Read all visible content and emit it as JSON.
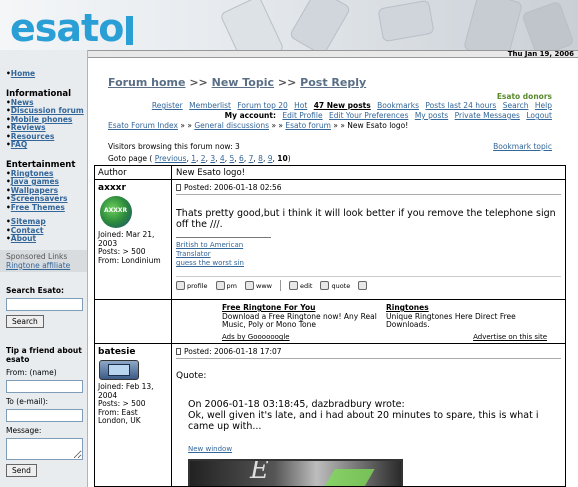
{
  "brand": {
    "logo": "esato"
  },
  "date": "Thu Jan 19, 2006",
  "sidebar": {
    "home": "Home",
    "informational_title": "Informational",
    "informational": [
      "News",
      "Discussion forum",
      "Mobile phones",
      "Reviews",
      "Resources",
      "FAQ"
    ],
    "entertainment_title": "Entertainment",
    "entertainment": [
      "Ringtones",
      "Java games",
      "Wallpapers",
      "Screensavers",
      "Free Themes"
    ],
    "misc": [
      "Sitemap",
      "Contact",
      "About"
    ],
    "sponsored_title": "Sponsored Links",
    "sponsored_link": "Ringtone affiliate",
    "search_label": "Search Esato:",
    "search_button": "Search",
    "tip_title": "Tip a friend about esato",
    "from_label": "From: (name)",
    "to_label": "To (e-mail):",
    "message_label": "Message:",
    "send_button": "Send"
  },
  "main": {
    "breadcrumb": {
      "home": "Forum home",
      "sep1": ">>",
      "new_topic": "New Topic",
      "sep2": ">>",
      "post_reply": "Post Reply"
    },
    "donors": "Esato donors",
    "nav": [
      "Register",
      "Memberlist",
      "Forum top 20",
      "Hot"
    ],
    "nav_bold": "47 New posts",
    "nav2": [
      "Bookmarks",
      "Posts last 24 hours",
      "Search",
      "Help"
    ],
    "account_label": "My account:",
    "account": [
      "Edit Profile",
      "Edit Your Preferences",
      "My posts",
      "Private Messages",
      "Logout"
    ],
    "index_path": [
      "Esato Forum Index",
      "General discussions",
      "Esato forum"
    ],
    "index_sep": "»",
    "index_current": "New Esato logo!",
    "browsing": "Visitors browsing this forum now: 3",
    "bookmark": "Bookmark topic",
    "goto_label": "Goto page (",
    "previous": "Previous",
    "pages": [
      "1",
      "2",
      "3",
      "4",
      "5",
      "6",
      "7",
      "8",
      "9"
    ],
    "current_page": "10",
    "goto_close": ")"
  },
  "thread": {
    "col_author": "Author",
    "title": "New Esato logo!",
    "post1": {
      "author": "axxxr",
      "avatar_text": "AXXXR",
      "joined": "Joined: Mar 21, 2003",
      "posts": "Posts: > 500",
      "from": "From: Londinium",
      "posted": "Posted: 2006-01-18 02:56",
      "body": "Thats pretty good,but i think it will look better if you remove the telephone sign off the ///.",
      "sig1": "British to American Translator",
      "sig2": "guess the worst sin",
      "tools": [
        "profile",
        "pm",
        "www",
        "edit",
        "quote"
      ]
    },
    "ads": {
      "ad1_title": "Free Ringtone For You",
      "ad1_text": "Download a Free Ringtone now! Any Real Music, Poly or Mono Tone",
      "ad2_title": "Ringtones",
      "ad2_text": "Unique Ringtones Here Direct Free Downloads.",
      "ads_by": "Ads by Goooooogle",
      "advertise": "Advertise on this site"
    },
    "post2": {
      "author": "batesie",
      "joined": "Joined: Feb 13, 2004",
      "posts": "Posts: > 500",
      "from": "From: East London, UK",
      "posted": "Posted: 2006-01-18 17:07",
      "quote_label": "Quote:",
      "quote_head": "On 2006-01-18 03:18:45, dazbradbury wrote:",
      "quote_body": "Ok, well given it's late, and i had about 20 minutes to spare, this is what i came up with...",
      "new_window": "New window"
    }
  }
}
